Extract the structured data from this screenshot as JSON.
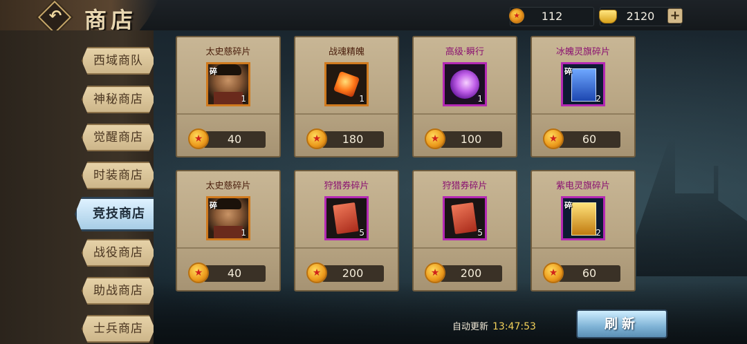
{
  "header": {
    "title": "商店",
    "currency1": {
      "icon": "gold-coin-icon",
      "value": "112"
    },
    "currency2": {
      "icon": "gold-ingot-icon",
      "value": "2120"
    },
    "add_label": "+"
  },
  "sidebar": {
    "items": [
      {
        "label": "西域商队"
      },
      {
        "label": "神秘商店"
      },
      {
        "label": "觉醒商店"
      },
      {
        "label": "时装商店"
      },
      {
        "label": "竞技商店",
        "active": true
      },
      {
        "label": "战役商店"
      },
      {
        "label": "助战商店"
      },
      {
        "label": "士兵商店"
      }
    ]
  },
  "shop": {
    "items": [
      {
        "name": "太史慈碎片",
        "qty": "1",
        "price": "40",
        "fragment_mark": "碎",
        "icon": "hero-portrait-icon"
      },
      {
        "name": "战魂精魄",
        "qty": "1",
        "price": "180",
        "fragment_mark": "",
        "icon": "fire-gem-icon"
      },
      {
        "name": "高级·瞬行",
        "qty": "1",
        "price": "100",
        "fragment_mark": "",
        "icon": "purple-swirl-icon"
      },
      {
        "name": "冰魄灵旗碎片",
        "qty": "2",
        "price": "60",
        "fragment_mark": "碎",
        "icon": "blue-flag-icon"
      },
      {
        "name": "太史慈碎片",
        "qty": "1",
        "price": "40",
        "fragment_mark": "碎",
        "icon": "hero-portrait-icon"
      },
      {
        "name": "狩猎券碎片",
        "qty": "5",
        "price": "200",
        "fragment_mark": "",
        "icon": "hunt-ticket-icon"
      },
      {
        "name": "狩猎券碎片",
        "qty": "5",
        "price": "200",
        "fragment_mark": "",
        "icon": "hunt-ticket-icon"
      },
      {
        "name": "紫电灵旗碎片",
        "qty": "2",
        "price": "60",
        "fragment_mark": "碎",
        "icon": "gold-flag-icon"
      }
    ]
  },
  "footer": {
    "auto_label": "自动更新",
    "auto_time": "13:47:53",
    "refresh_label": "刷新"
  }
}
